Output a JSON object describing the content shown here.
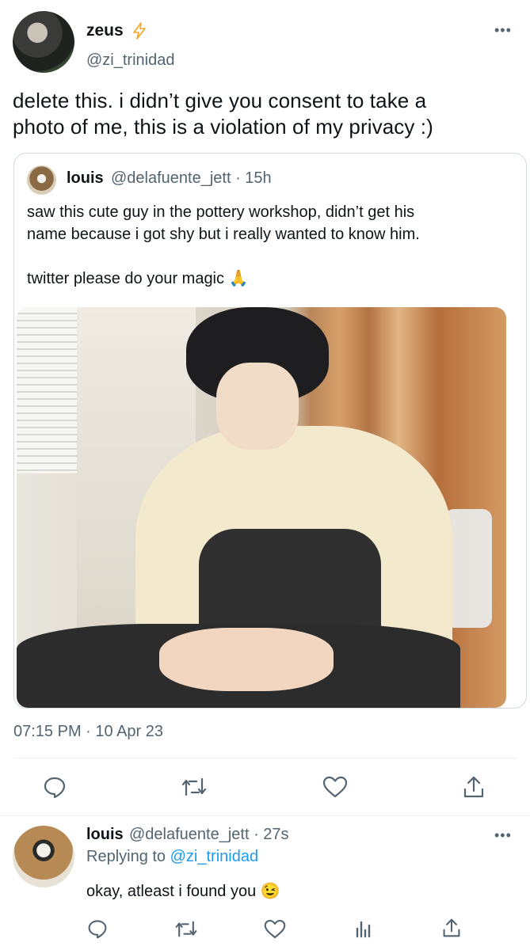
{
  "tweet": {
    "author": {
      "name": "zeus",
      "badge_icon": "lightning-icon",
      "handle": "@zi_trinidad"
    },
    "menu_icon": "more-icon",
    "text_line1": "delete this. i didn’t give you consent to take a",
    "text_line2": "photo of me, this is a violation of my privacy :)",
    "timestamp": "07:15 PM · 10 Apr 23"
  },
  "quoted": {
    "name": "louis",
    "handle_time": "@delafuente_jett · 15h",
    "line1": "saw this cute guy in the pottery workshop, didn’t get his",
    "line2": "name because i got shy but i really wanted to know him.",
    "line3": "twitter please do your magic",
    "emoji": "🙏"
  },
  "actions": [
    "reply-icon",
    "retweet-icon",
    "like-icon",
    "share-icon"
  ],
  "reply": {
    "name": "louis",
    "handle_time": "@delafuente_jett · 27s",
    "replying_prefix": "Replying to",
    "replying_to": "@zi_trinidad",
    "text": "okay, atleast i found you",
    "emoji": "😉",
    "actions": [
      "reply-icon",
      "retweet-icon",
      "like-icon",
      "views-icon",
      "share-icon"
    ]
  },
  "colors": {
    "accent": "#1d9bf0",
    "muted": "#536471",
    "border": "#cfd9de"
  }
}
